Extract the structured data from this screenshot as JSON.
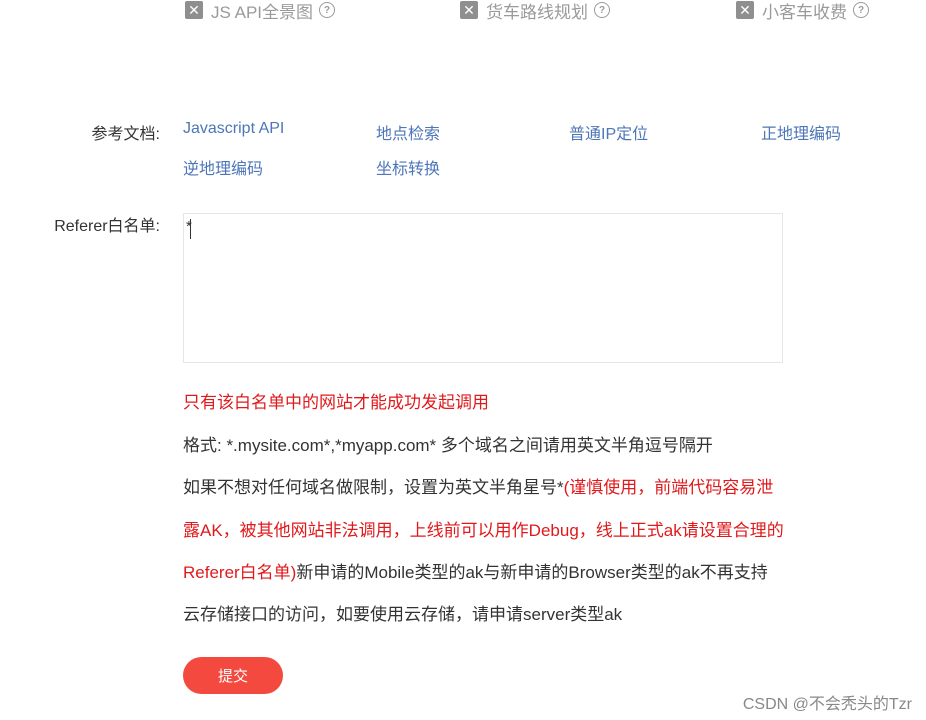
{
  "services": [
    {
      "label": "JS API全景图",
      "checked": false,
      "icon": "x-box-icon"
    },
    {
      "label": "货车路线规划",
      "checked": false,
      "icon": "x-box-icon"
    },
    {
      "label": "小客车收费",
      "checked": false,
      "icon": "x-box-icon"
    }
  ],
  "help_glyph": "?",
  "docs": {
    "label": "参考文档:",
    "links": [
      "Javascript API",
      "地点检索",
      "普通IP定位",
      "正地理编码",
      "逆地理编码",
      "坐标转换"
    ]
  },
  "referer": {
    "label": "Referer白名单:",
    "value": "*"
  },
  "notes": {
    "warning": "只有该白名单中的网站才能成功发起调用",
    "format": "格式: *.mysite.com*,*myapp.com* 多个域名之间请用英文半角逗号隔开",
    "line3_black": "如果不想对任何域名做限制，设置为英文半角星号*",
    "line3_red": "(谨慎使用，前端代码容易泄",
    "line4_red": "露AK，被其他网站非法调用，上线前可以用作Debug，线上正式ak请设置合理的",
    "line5_red": "Referer白名单)",
    "line5_black": "新申请的Mobile类型的ak与新申请的Browser类型的ak不再支持",
    "line6": "云存储接口的访问，如要使用云存储，请申请server类型ak"
  },
  "submit_label": "提交",
  "watermark": "CSDN @不会秃头的Tzr",
  "colors": {
    "link": "#4d76b8",
    "warning": "#e0191b",
    "button": "#f4493f"
  }
}
